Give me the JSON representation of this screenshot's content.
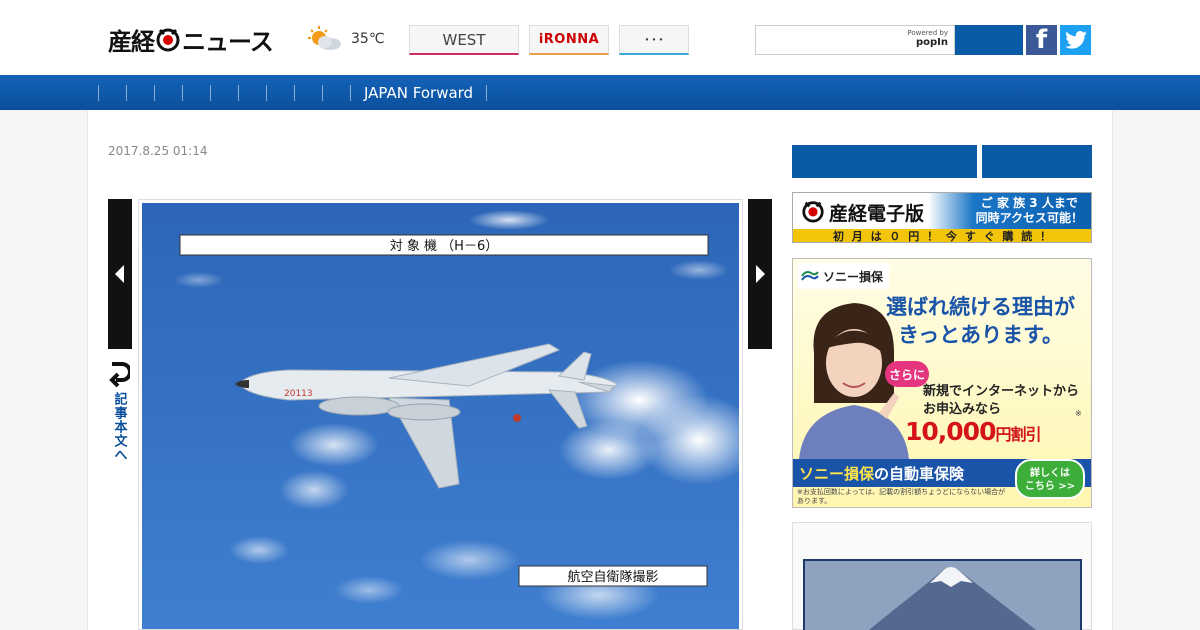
{
  "header": {
    "logo_text": "産経ニュース",
    "weather": {
      "temperature": "35℃",
      "icon": "sun-cloud-icon"
    },
    "tabs": [
      {
        "label": "WEST",
        "accent": "#c72e5f"
      },
      {
        "label": "iRONNA",
        "accent": "#e8a04b"
      },
      {
        "label": "･･･",
        "accent": "#3aa6d9"
      }
    ],
    "search": {
      "placeholder": "",
      "powered_by": "Powered by",
      "provider": "popIn"
    },
    "social": {
      "facebook": "f",
      "twitter": "twitter-icon"
    }
  },
  "navbar": {
    "items": [
      "JAPAN Forward"
    ],
    "color": "#0b4f9c"
  },
  "article": {
    "date": "2017.8.25 01:14",
    "back_link": "記事本文へ",
    "photo": {
      "caption_top": "対 象 機 （H－6）",
      "caption_bottom": "航空自衛隊撮影",
      "aircraft_tail": "20113"
    }
  },
  "sidebar": {
    "ad_digital": {
      "brand": "産経電子版",
      "promo_line1": "ご 家 族 3 人まで",
      "promo_line2": "同時アクセス可能！",
      "bottom": "初 月 は ０ 円 ！ 今 す ぐ 購 読 ！"
    },
    "ad_sony": {
      "logo": "ソニー損保",
      "headline_line1": "選ばれ続ける理由が",
      "headline_line2": "きっとあります。",
      "tag": "さらに",
      "sub_line1": "新規でインターネットから",
      "sub_line2": "お申込みなら",
      "price": "10,000",
      "price_unit": "円割引",
      "note_mark": "※",
      "bar_prefix": "ソニー損保",
      "bar_suffix": "の自動車保険",
      "cta_line1": "詳しくは",
      "cta_line2": "こちら >>",
      "footnote": "※お支払回数によっては、記載の割引額ちょうどにならない場合があります。"
    }
  }
}
